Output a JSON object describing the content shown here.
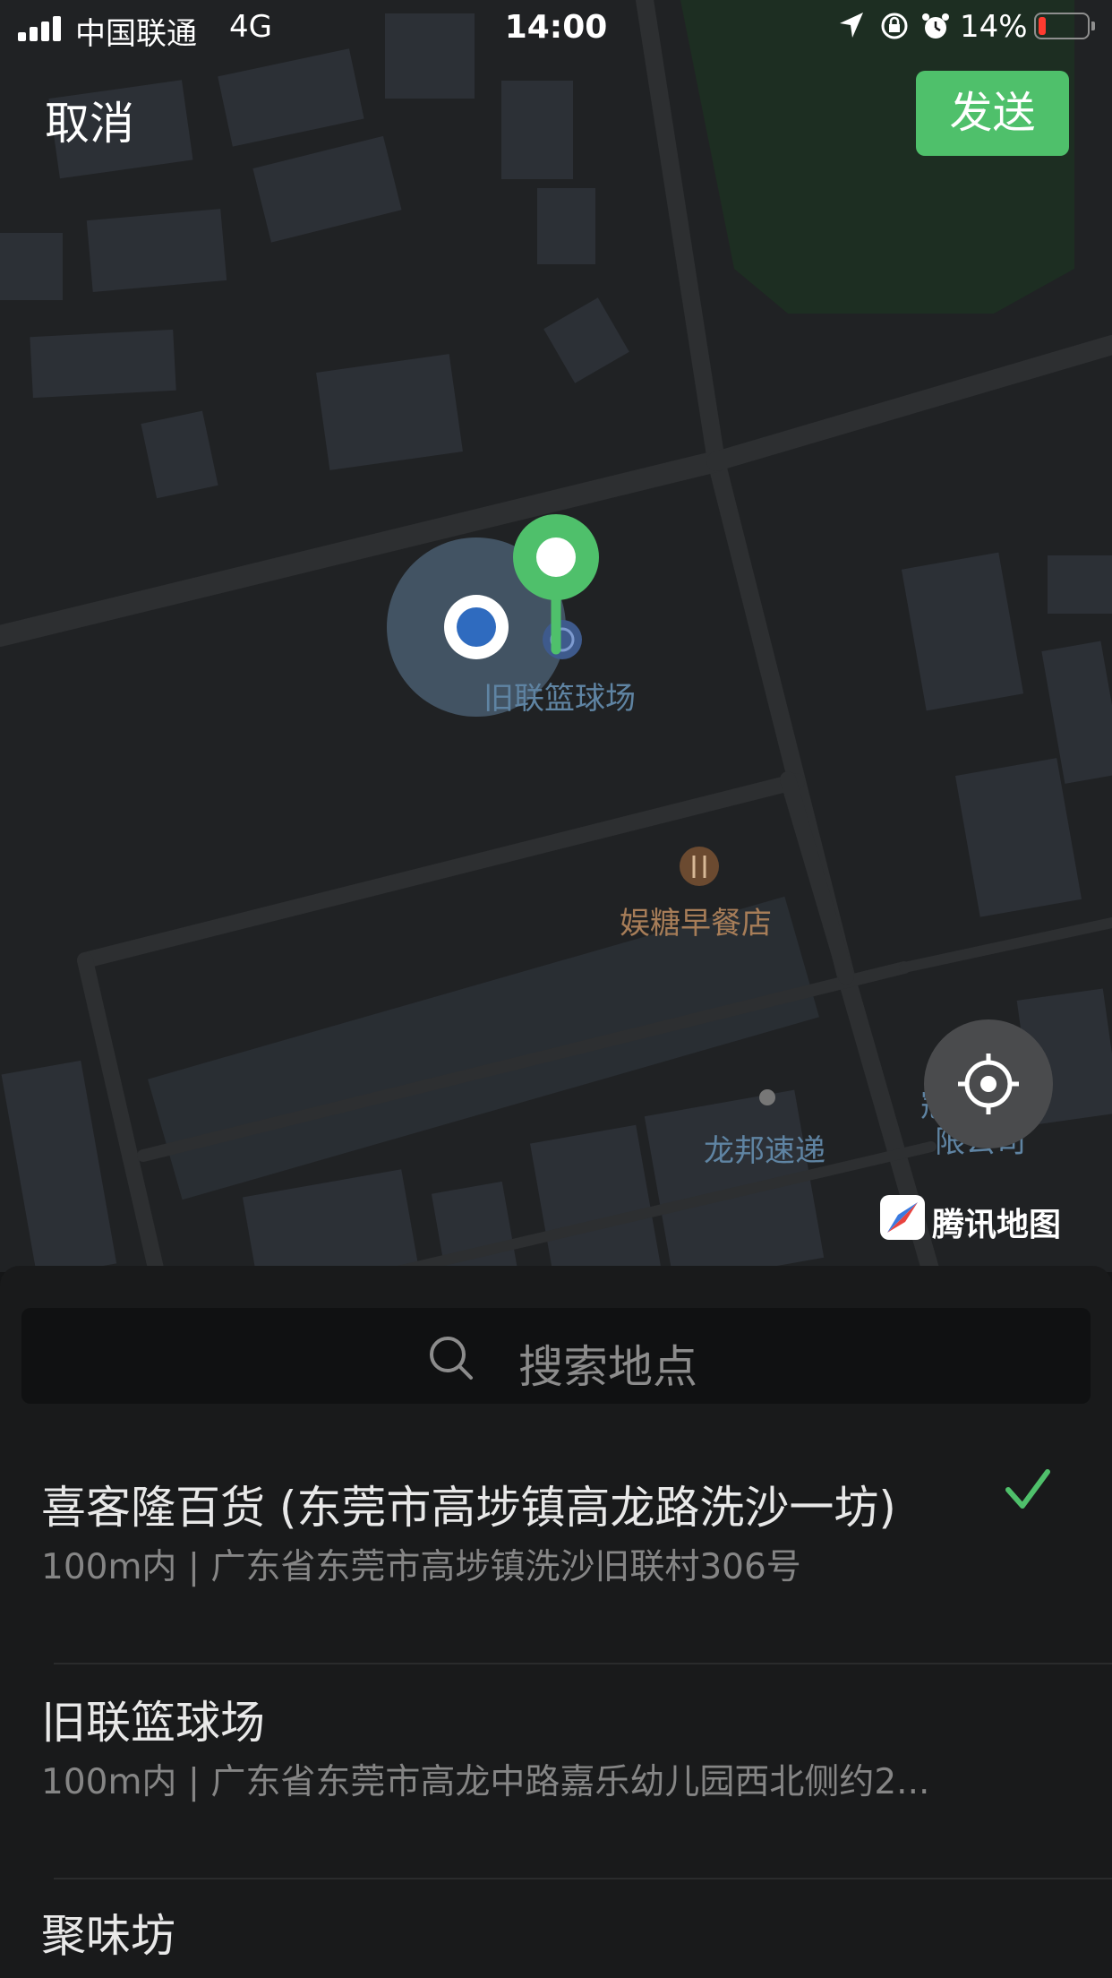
{
  "status_bar": {
    "carrier": "中国联通",
    "network": "4G",
    "time": "14:00",
    "battery_percent": "14%",
    "icons": [
      "signal-icon",
      "location-arrow-icon",
      "rotation-lock-icon",
      "alarm-icon",
      "battery-icon"
    ]
  },
  "top_bar": {
    "cancel_label": "取消",
    "send_label": "发送"
  },
  "map": {
    "poi_labels": {
      "basketball": "旧联篮球场",
      "breakfast": "娱糖早餐店",
      "express": "龙邦速递",
      "company_line1": "冠五",
      "company_line2": "限公司"
    },
    "attribution": "腾讯地图",
    "colors": {
      "map_bg": "#202224",
      "road": "#2d2f31",
      "building": "#2c3036",
      "park": "#1d2e22",
      "pin": "#4fc06b",
      "my_location": "#2f6bbf"
    }
  },
  "search": {
    "placeholder": "搜索地点"
  },
  "places": [
    {
      "title": "喜客隆百货 (东莞市高埗镇高龙路洗沙一坊)",
      "subtitle": "100m内 | 广东省东莞市高埗镇洗沙旧联村306号",
      "selected": true
    },
    {
      "title": "旧联篮球场",
      "subtitle": "100m内 | 广东省东莞市高龙中路嘉乐幼儿园西北侧约2...",
      "selected": false
    },
    {
      "title": "聚味坊",
      "subtitle": "",
      "selected": false
    }
  ],
  "accent_color": "#4fc06b"
}
